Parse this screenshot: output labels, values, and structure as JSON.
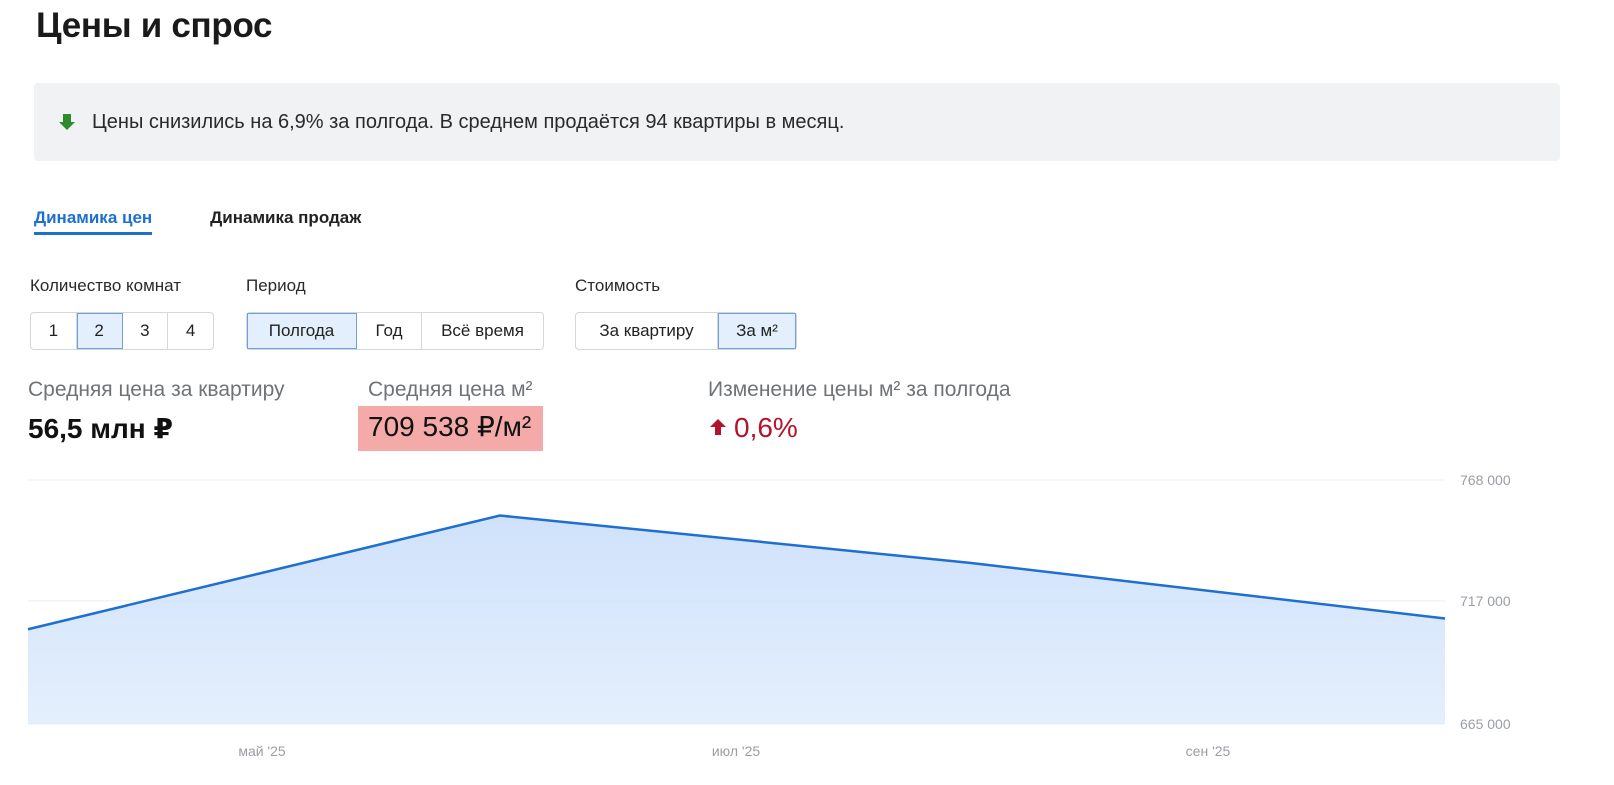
{
  "page": {
    "title": "Цены и спрос"
  },
  "banner": {
    "icon": "arrow-down-icon",
    "icon_color": "#2e8b2e",
    "text": "Цены снизились на 6,9% за полгода. В среднем продаётся 94 квартиры в месяц."
  },
  "tabs": [
    {
      "label": "Динамика цен",
      "active": true
    },
    {
      "label": "Динамика продаж",
      "active": false
    }
  ],
  "filters": {
    "rooms": {
      "label": "Количество комнат",
      "options": [
        "1",
        "2",
        "3",
        "4"
      ],
      "selected": "2"
    },
    "period": {
      "label": "Период",
      "options": [
        "Полгода",
        "Год",
        "Всё время"
      ],
      "selected": "Полгода"
    },
    "cost": {
      "label": "Стоимость",
      "options": [
        "За квартиру",
        "За м²"
      ],
      "selected": "За м²"
    }
  },
  "stats": {
    "avg_price": {
      "label": "Средняя цена за квартиру",
      "value": "56,5 млн ₽"
    },
    "avg_price_m2": {
      "label": "Средняя цена м²",
      "value": "709 538 ₽/м²"
    },
    "change_m2": {
      "label": "Изменение цены м² за полгода",
      "value": "0,6%",
      "icon": "arrow-up-icon",
      "color": "#b5122e"
    }
  },
  "chart_data": {
    "type": "area",
    "x": [
      "2025-04",
      "2025-06",
      "2025-08",
      "2025-10"
    ],
    "y": [
      705000,
      753000,
      733000,
      709538
    ],
    "x_ticks": [
      "май '25",
      "июл '25",
      "сен '25"
    ],
    "y_ticks": [
      "768 000",
      "717 000",
      "665 000"
    ],
    "ylim": [
      665000,
      768000
    ],
    "line_color": "#1f6fcf",
    "fill_color": "#cfe2fb",
    "grid": true
  }
}
